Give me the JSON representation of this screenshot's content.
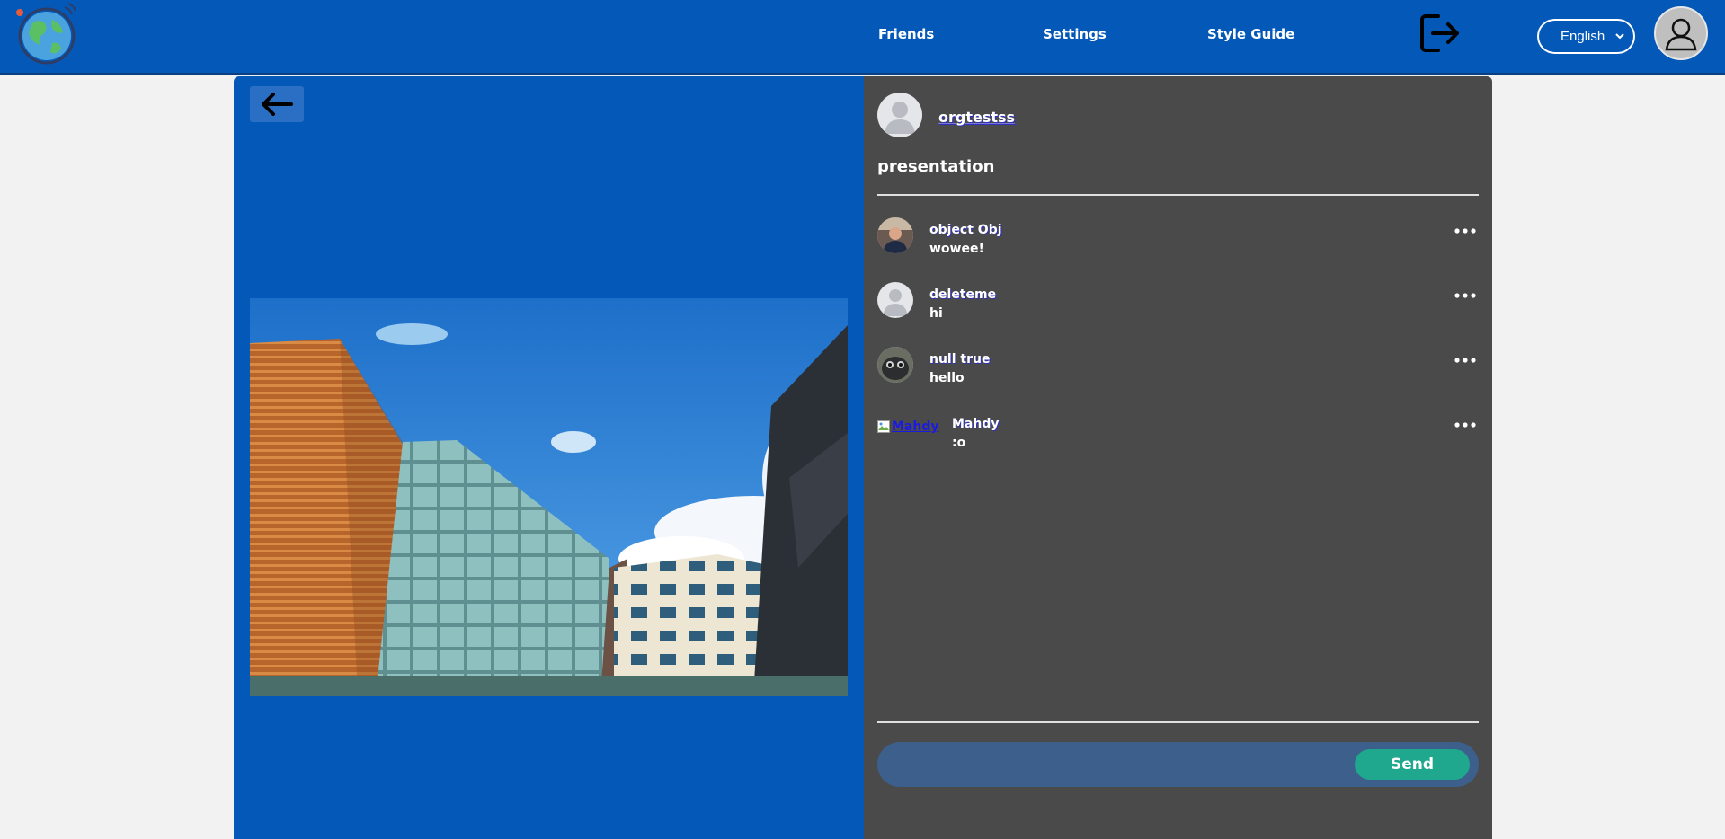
{
  "header": {
    "nav": [
      "Friends",
      "Settings",
      "Style Guide"
    ],
    "language": "English",
    "colors": {
      "bar": "#0459b8"
    }
  },
  "post": {
    "owner": "orgtestss",
    "caption": "presentation"
  },
  "comments": [
    {
      "name": "object Obj",
      "text": "wowee!"
    },
    {
      "name": "deleteme",
      "text": "hi"
    },
    {
      "name": "null true",
      "text": "hello"
    },
    {
      "name": "Mahdy",
      "text": ":o",
      "broken_avatar_alt": "Mahdy"
    }
  ],
  "composer": {
    "placeholder": "",
    "send_label": "Send",
    "colors": {
      "send": "#1fa88e"
    }
  }
}
